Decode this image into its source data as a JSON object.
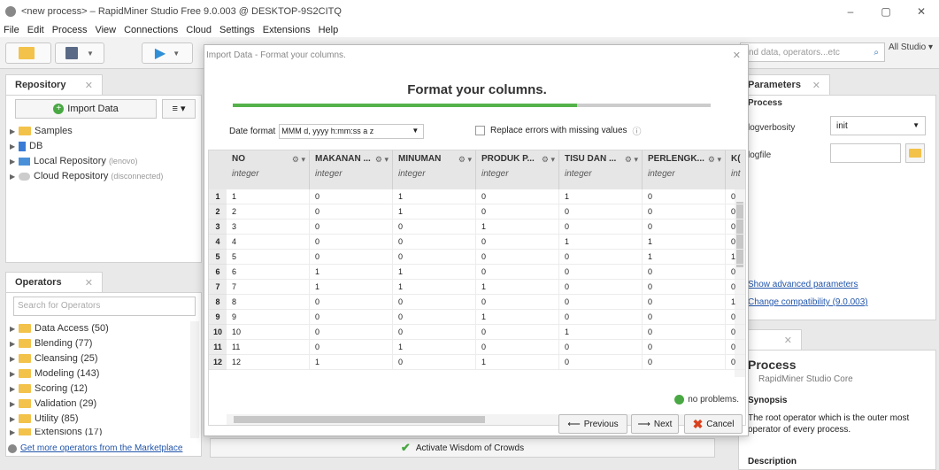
{
  "window": {
    "title": "<new process> – RapidMiner Studio Free 9.0.003 @ DESKTOP-9S2CITQ",
    "minimize": "–",
    "maximize": "▢",
    "close": "✕"
  },
  "menu": [
    "File",
    "Edit",
    "Process",
    "View",
    "Connections",
    "Cloud",
    "Settings",
    "Extensions",
    "Help"
  ],
  "search": {
    "placeholder": "find data, operators...etc",
    "scope": "All Studio ▾"
  },
  "repository": {
    "tab": "Repository",
    "import_button": "Import Data",
    "items": [
      {
        "label": "Samples",
        "note": ""
      },
      {
        "label": "DB",
        "note": ""
      },
      {
        "label": "Local Repository",
        "note": "(lenovo)"
      },
      {
        "label": "Cloud Repository",
        "note": "(disconnected)"
      }
    ]
  },
  "operators": {
    "tab": "Operators",
    "search_placeholder": "Search for Operators",
    "items": [
      "Data Access (50)",
      "Blending (77)",
      "Cleansing (25)",
      "Modeling (143)",
      "Scoring (12)",
      "Validation (29)",
      "Utility (85)",
      "Extensions (17)"
    ],
    "marketplace": "Get more operators from the Marketplace"
  },
  "dialog": {
    "title": "Import Data - Format your columns.",
    "heading": "Format your columns.",
    "progress": 0.72,
    "date_label": "Date format",
    "date_value": "MMM d, yyyy h:mm:ss a z",
    "replace_label": "Replace errors with missing values",
    "columns": [
      {
        "name": "NO",
        "type": "integer"
      },
      {
        "name": "MAKANAN ...",
        "type": "integer"
      },
      {
        "name": "MINUMAN",
        "type": "integer"
      },
      {
        "name": "PRODUK P...",
        "type": "integer"
      },
      {
        "name": "TISU DAN ...",
        "type": "integer"
      },
      {
        "name": "PERLENGK...",
        "type": "integer"
      },
      {
        "name": "K(",
        "type": "int"
      }
    ],
    "rows": [
      [
        "1",
        "1",
        "0",
        "1",
        "0",
        "1",
        "0",
        "0"
      ],
      [
        "2",
        "2",
        "0",
        "1",
        "0",
        "0",
        "0",
        "0"
      ],
      [
        "3",
        "3",
        "0",
        "0",
        "1",
        "0",
        "0",
        "0"
      ],
      [
        "4",
        "4",
        "0",
        "0",
        "0",
        "1",
        "1",
        "0"
      ],
      [
        "5",
        "5",
        "0",
        "0",
        "0",
        "0",
        "1",
        "1"
      ],
      [
        "6",
        "6",
        "1",
        "1",
        "0",
        "0",
        "0",
        "0"
      ],
      [
        "7",
        "7",
        "1",
        "1",
        "1",
        "0",
        "0",
        "0"
      ],
      [
        "8",
        "8",
        "0",
        "0",
        "0",
        "0",
        "0",
        "1"
      ],
      [
        "9",
        "9",
        "0",
        "0",
        "1",
        "0",
        "0",
        "0"
      ],
      [
        "10",
        "10",
        "0",
        "0",
        "0",
        "1",
        "0",
        "0"
      ],
      [
        "11",
        "11",
        "0",
        "1",
        "0",
        "0",
        "0",
        "0"
      ],
      [
        "12",
        "12",
        "1",
        "0",
        "1",
        "0",
        "0",
        "0"
      ]
    ],
    "status": "no problems.",
    "previous": "Previous",
    "next": "Next",
    "cancel": "Cancel"
  },
  "parameters": {
    "tab": "Parameters",
    "header": "Process",
    "verbosity_label": "logverbosity",
    "verbosity_value": "init",
    "file_label": "logfile",
    "show_advanced": "Show advanced parameters",
    "change_compat": "Change compatibility (9.0.003)"
  },
  "help": {
    "title": "Process",
    "subtitle": "RapidMiner Studio Core",
    "synopsis": "Synopsis",
    "synopsis_text": "The root operator which is the outer most operator of every process.",
    "description": "Description"
  },
  "bottom": {
    "wisdom": "Activate Wisdom of Crowds"
  },
  "colors": {
    "accent_green": "#49a843",
    "folder": "#f3c24a",
    "link": "#2255aa"
  }
}
